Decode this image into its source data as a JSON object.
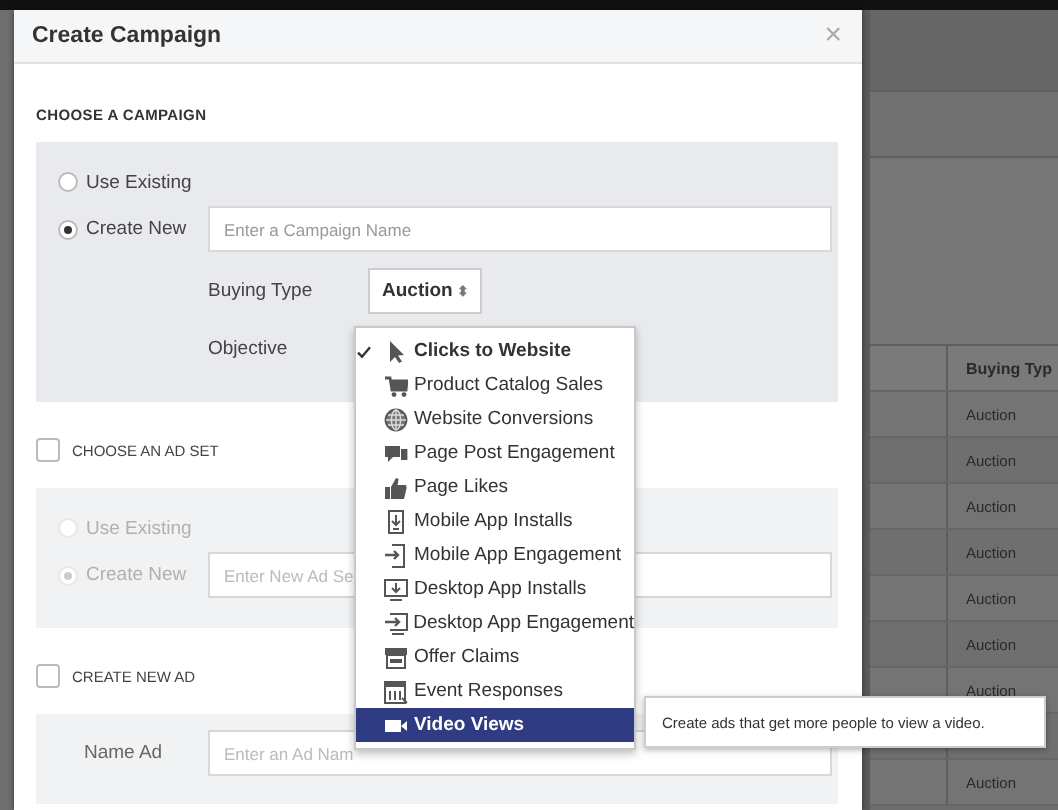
{
  "background_table": {
    "column_header": "Buying Typ",
    "rows": [
      {
        "buying_type": "Auction"
      },
      {
        "buying_type": "Auction"
      },
      {
        "buying_type": "Auction"
      },
      {
        "buying_type": "Auction"
      },
      {
        "buying_type": "Auction"
      },
      {
        "buying_type": "Auction"
      },
      {
        "buying_type": "Auction"
      },
      {},
      {
        "buying_type": "Auction"
      }
    ]
  },
  "dialog": {
    "title": "Create Campaign",
    "close": "×",
    "campaign": {
      "heading": "CHOOSE A CAMPAIGN",
      "options": [
        {
          "label": "Use Existing",
          "selected": false
        },
        {
          "label": "Create New",
          "selected": true
        }
      ],
      "name_field": {
        "placeholder": "Enter a Campaign Name"
      },
      "buying_type": {
        "label": "Buying Type",
        "value": "Auction",
        "caret": "⬍"
      },
      "objective": {
        "label": "Objective",
        "menu": [
          {
            "label": "Clicks to Website",
            "checked": true,
            "highlighted": false
          },
          {
            "label": "Product Catalog Sales",
            "checked": false,
            "highlighted": false
          },
          {
            "label": "Website Conversions",
            "checked": false,
            "highlighted": false
          },
          {
            "label": "Page Post Engagement",
            "checked": false,
            "highlighted": false
          },
          {
            "label": "Page Likes",
            "checked": false,
            "highlighted": false
          },
          {
            "label": "Mobile App Installs",
            "checked": false,
            "highlighted": false
          },
          {
            "label": "Mobile App Engagement",
            "checked": false,
            "highlighted": false
          },
          {
            "label": "Desktop App Installs",
            "checked": false,
            "highlighted": false
          },
          {
            "label": "Desktop App Engagement",
            "checked": false,
            "highlighted": false
          },
          {
            "label": "Offer Claims",
            "checked": false,
            "highlighted": false
          },
          {
            "label": "Event Responses",
            "checked": false,
            "highlighted": false
          },
          {
            "label": "Video Views",
            "checked": false,
            "highlighted": true
          }
        ],
        "tooltip": "Create ads that get more people to view a video."
      }
    },
    "ad_set": {
      "heading": "CHOOSE AN AD SET",
      "checked": false,
      "options": [
        {
          "label": "Use Existing",
          "selected": false,
          "disabled": true
        },
        {
          "label": "Create New",
          "selected": true,
          "disabled": true
        }
      ],
      "name_field": {
        "placeholder": "Enter New Ad Se"
      }
    },
    "ad": {
      "heading": "CREATE NEW AD",
      "checked": false,
      "name_label": "Name Ad",
      "name_field": {
        "placeholder": "Enter an Ad Nam"
      }
    }
  }
}
